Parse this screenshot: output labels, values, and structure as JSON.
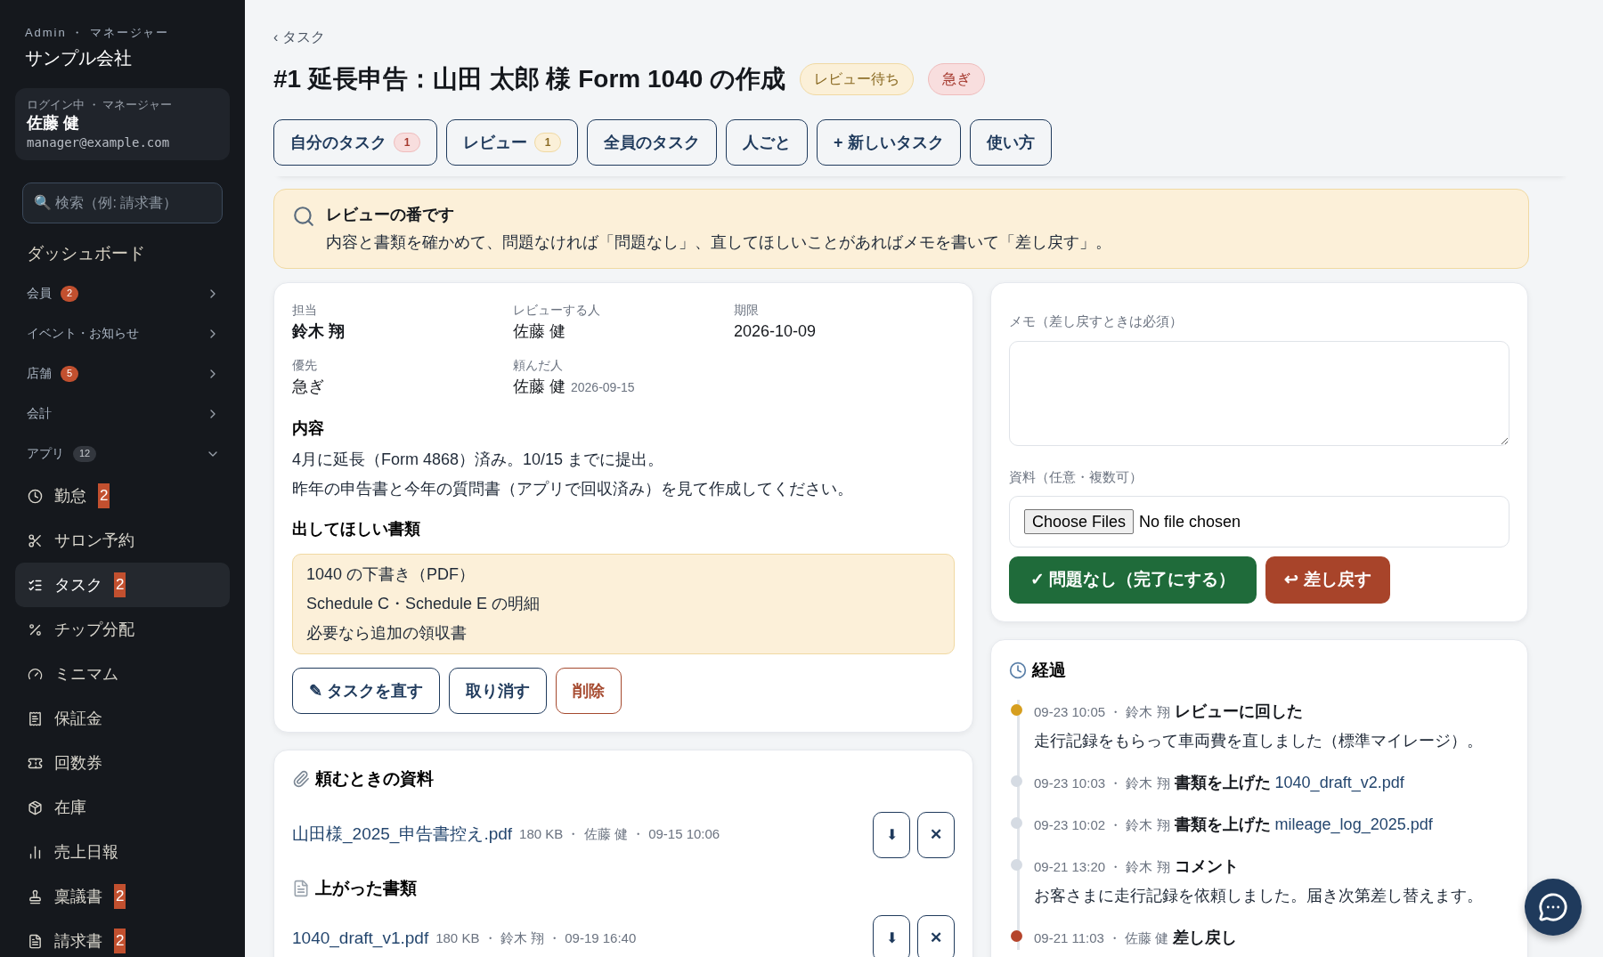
{
  "sidebar": {
    "role_line": "Admin ・ マネージャー",
    "company": "サンプル会社",
    "login": {
      "label": "ログイン中 ・ マネージャー",
      "name": "佐藤 健",
      "email": "manager@example.com"
    },
    "search": {
      "placeholder": "🔍 検索（例: 請求書）"
    },
    "dashboard": "ダッシュボード",
    "groups": [
      {
        "label": "会員",
        "badge": {
          "text": "2",
          "kind": "alert"
        },
        "expanded": false
      },
      {
        "label": "イベント・お知らせ",
        "expanded": false
      },
      {
        "label": "店舗",
        "badge": {
          "text": "5",
          "kind": "alert"
        },
        "expanded": false
      },
      {
        "label": "会計",
        "expanded": false
      },
      {
        "label": "アプリ",
        "badge": {
          "text": "12",
          "kind": "count"
        },
        "expanded": true
      }
    ],
    "apps": [
      {
        "label": "勤怠",
        "badge": "2",
        "selected": false
      },
      {
        "label": "サロン予約",
        "selected": false
      },
      {
        "label": "タスク",
        "badge": "2",
        "selected": true
      },
      {
        "label": "チップ分配",
        "selected": false
      },
      {
        "label": "ミニマム",
        "selected": false
      },
      {
        "label": "保証金",
        "selected": false
      },
      {
        "label": "回数券",
        "selected": false
      },
      {
        "label": "在庫",
        "selected": false
      },
      {
        "label": "売上日報",
        "selected": false
      },
      {
        "label": "稟議書",
        "badge": "2",
        "selected": false
      },
      {
        "label": "請求書",
        "badge": "2",
        "selected": false
      }
    ]
  },
  "header": {
    "breadcrumb": "‹ タスク",
    "title": "#1 延長申告：山田 太郎 様 Form 1040 の作成",
    "tags": [
      {
        "label": "レビュー待ち",
        "kind": "warning"
      },
      {
        "label": "急ぎ",
        "kind": "danger"
      }
    ],
    "tabs": [
      {
        "label": "自分のタスク",
        "badge": {
          "text": "1",
          "kind": "danger"
        }
      },
      {
        "label": "レビュー",
        "badge": {
          "text": "1",
          "kind": "warning"
        }
      },
      {
        "label": "全員のタスク"
      },
      {
        "label": "人ごと"
      },
      {
        "label": "+ 新しいタスク"
      },
      {
        "label": "使い方"
      }
    ]
  },
  "banner": {
    "title": "レビューの番です",
    "text": "内容と書類を確かめて、問題なければ「問題なし」、直してほしいことがあればメモを書いて「差し戻す」。"
  },
  "details": {
    "fields": [
      {
        "label": "担当",
        "value": "鈴木 翔",
        "bold": true
      },
      {
        "label": "レビューする人",
        "value": "佐藤 健",
        "bold": false
      },
      {
        "label": "期限",
        "value": "2026-10-09",
        "bold": false
      },
      {
        "label": "優先",
        "value": "急ぎ",
        "bold": false
      },
      {
        "label": "頼んだ人",
        "value": "佐藤 健",
        "note": "2026-09-15",
        "bold": false
      }
    ],
    "content_heading": "内容",
    "content_lines": [
      "4月に延長（Form 4868）済み。10/15 までに提出。",
      "昨年の申告書と今年の質問書（アプリで回収済み）を見て作成してください。"
    ],
    "docs_heading": "出してほしい書類",
    "docs": [
      "1040 の下書き（PDF）",
      "Schedule C・Schedule E の明細",
      "必要なら追加の領収書"
    ],
    "actions": [
      {
        "label": "✎ タスクを直す",
        "kind": "outline"
      },
      {
        "label": "取り消す",
        "kind": "outline"
      },
      {
        "label": "削除",
        "kind": "danger"
      }
    ]
  },
  "attachments": {
    "heading": "頼むときの資料",
    "files": [
      {
        "name": "山田様_2025_申告書控え.pdf",
        "meta": "180 KB ・ 佐藤 健 ・ 09-15 10:06"
      }
    ],
    "uploaded_heading": "上がった書類",
    "uploaded": [
      {
        "name": "1040_draft_v1.pdf",
        "meta": "180 KB ・ 鈴木 翔 ・ 09-19 16:40"
      }
    ],
    "download": "⬇",
    "remove": "✕"
  },
  "review": {
    "memo_label": "メモ（差し戻すときは必須）",
    "files_label": "資料（任意・複数可）",
    "file_button": "Choose Files",
    "file_status": "No file chosen",
    "approve": "✓ 問題なし（完了にする）",
    "return": "↩ 差し戻す"
  },
  "history": {
    "heading": "経過",
    "entries": [
      {
        "meta": "09-23 10:05 ・ 鈴木 翔",
        "action": "レビューに回した",
        "note": "走行記録をもらって車両費を直しました（標準マイレージ）。",
        "color": "#d69e1f"
      },
      {
        "meta": "09-23 10:03 ・ 鈴木 翔",
        "action": "書類を上げた",
        "link": "1040_draft_v2.pdf",
        "color": "#d5dbe3"
      },
      {
        "meta": "09-23 10:02 ・ 鈴木 翔",
        "action": "書類を上げた",
        "link": "mileage_log_2025.pdf",
        "color": "#d5dbe3"
      },
      {
        "meta": "09-21 13:20 ・ 鈴木 翔",
        "action": "コメント",
        "note": "お客さまに走行記録を依頼しました。届き次第差し替えます。",
        "color": "#d5dbe3"
      },
      {
        "meta": "09-21 11:03 ・ 佐藤 健",
        "action": "差し戻し",
        "color": "#b5442b"
      }
    ]
  }
}
